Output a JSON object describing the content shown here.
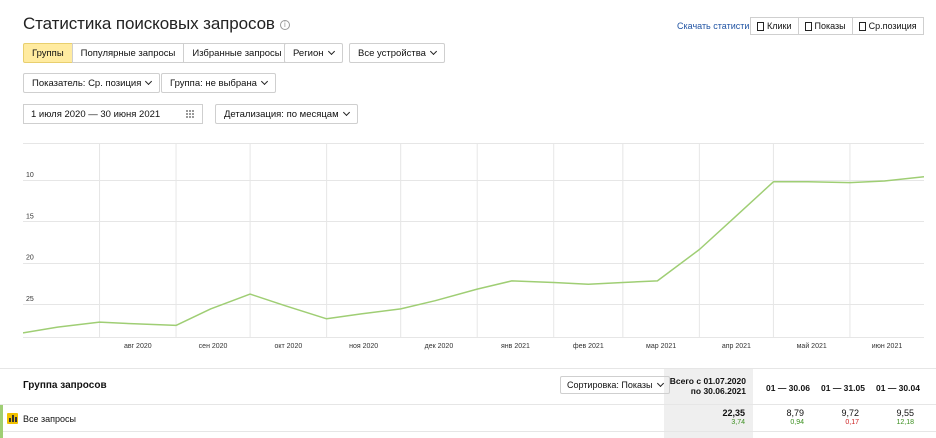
{
  "page": {
    "title": "Статистика поисковых запросов",
    "info_icon": "info-icon",
    "download_link": "Скачать статистику",
    "metric_tabs": [
      "Клики",
      "Показы",
      "Ср.позиция"
    ]
  },
  "filters": {
    "segments": [
      {
        "label": "Группы",
        "active": true
      },
      {
        "label": "Популярные запросы",
        "active": false
      },
      {
        "label": "Избранные запросы",
        "active": false
      }
    ],
    "region": "Регион",
    "devices": "Все устройства",
    "indicator": "Показатель: Ср. позиция",
    "group": "Группа: не выбрана",
    "date_range": "1 июля 2020 — 30 июня 2021",
    "detail": "Детализация: по месяцам"
  },
  "chart_data": {
    "type": "line",
    "title": "",
    "xlabel": "",
    "ylabel": "",
    "y_inverted": true,
    "ylim": [
      5.5,
      29
    ],
    "y_ticks": [
      10,
      15,
      20,
      25
    ],
    "x_tick_labels": [
      "авг 2020",
      "сен 2020",
      "окт 2020",
      "ноя 2020",
      "дек 2020",
      "янв 2021",
      "фев 2021",
      "мар 2021",
      "апр 2021",
      "май 2021",
      "июн 2021"
    ],
    "grid": true,
    "colors": {
      "line": "#9fce74",
      "grid": "#e6e6e6"
    },
    "series": [
      {
        "x": [
          "2020-07-01",
          "2020-07-15",
          "2020-08-01",
          "2020-08-15",
          "2020-09-01",
          "2020-09-15",
          "2020-10-01",
          "2020-10-15",
          "2020-11-01",
          "2020-11-15",
          "2020-12-01",
          "2020-12-15",
          "2021-01-01",
          "2021-01-15",
          "2021-02-01",
          "2021-02-15",
          "2021-03-01",
          "2021-03-15",
          "2021-04-01",
          "2021-04-15",
          "2021-05-01",
          "2021-05-15",
          "2021-06-01",
          "2021-06-15",
          "2021-07-01"
        ],
        "values": [
          28.5,
          27.8,
          27.2,
          27.4,
          27.6,
          25.6,
          23.8,
          25.2,
          26.8,
          26.2,
          25.6,
          24.6,
          23.2,
          22.2,
          22.4,
          22.6,
          22.4,
          22.2,
          18.4,
          14.6,
          10.2,
          10.2,
          10.3,
          10.1,
          9.6
        ]
      }
    ]
  },
  "table": {
    "group_header": "Группа запросов",
    "sort_label": "Сортировка: Показы",
    "total_header_line1": "Всего с 01.07.2020",
    "total_header_line2": "по 30.06.2021",
    "periods": [
      "01 — 30.06",
      "01 — 31.05",
      "01 — 30.04"
    ],
    "rows": [
      {
        "label": "Все запросы",
        "icon": "bar-chart-icon",
        "total": {
          "value": "22,35",
          "delta": "3,74",
          "trend": "positive"
        },
        "cells": [
          {
            "value": "8,79",
            "delta": "0,94",
            "trend": "positive"
          },
          {
            "value": "9,72",
            "delta": "0,17",
            "trend": "negative"
          },
          {
            "value": "9,55",
            "delta": "12,18",
            "trend": "positive"
          }
        ]
      }
    ]
  }
}
